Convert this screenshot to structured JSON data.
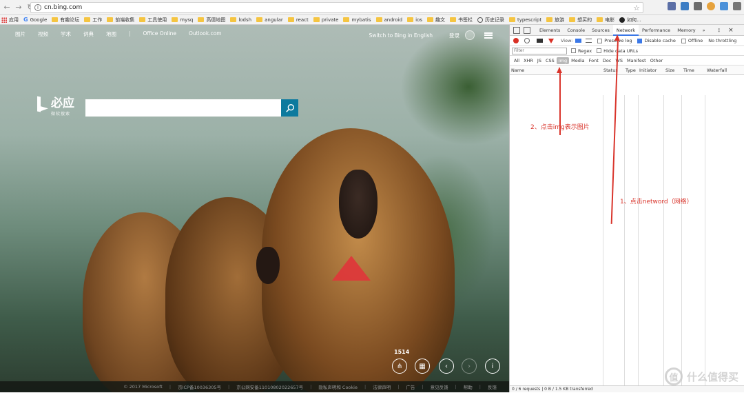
{
  "browser": {
    "url": "cn.bing.com"
  },
  "bookmarks": [
    {
      "label": "应用",
      "icon": "apps-icon"
    },
    {
      "label": "Google",
      "icon": "g-icon"
    },
    {
      "label": "有趣论坛",
      "icon": "folder-icon"
    },
    {
      "label": "工作",
      "icon": "folder-icon"
    },
    {
      "label": "前端收集",
      "icon": "folder-icon"
    },
    {
      "label": "工具使用",
      "icon": "folder-icon"
    },
    {
      "label": "mysq",
      "icon": "folder-icon"
    },
    {
      "label": "高德地图",
      "icon": "folder-icon"
    },
    {
      "label": "lodsh",
      "icon": "folder-icon"
    },
    {
      "label": "angular",
      "icon": "folder-icon"
    },
    {
      "label": "react",
      "icon": "folder-icon"
    },
    {
      "label": "private",
      "icon": "folder-icon"
    },
    {
      "label": "mybatis",
      "icon": "folder-icon"
    },
    {
      "label": "android",
      "icon": "folder-icon"
    },
    {
      "label": "ios",
      "icon": "folder-icon"
    },
    {
      "label": "趣文",
      "icon": "folder-icon"
    },
    {
      "label": "书签栏",
      "icon": "folder-icon"
    },
    {
      "label": "历史记录",
      "icon": "history-icon"
    },
    {
      "label": "typescript",
      "icon": "folder-icon"
    },
    {
      "label": "旅游",
      "icon": "folder-icon"
    },
    {
      "label": "想买的",
      "icon": "folder-icon"
    },
    {
      "label": "电影",
      "icon": "folder-icon"
    },
    {
      "label": "如何...",
      "icon": "github-icon"
    }
  ],
  "bing": {
    "nav": [
      "图片",
      "视频",
      "学术",
      "词典",
      "地图"
    ],
    "nav_right": [
      "Office Online",
      "Outlook.com"
    ],
    "switch_lang": "Switch to Bing in English",
    "login": "登录",
    "logo_cn": "必应",
    "logo_sub": "微软搜索",
    "search_value": "",
    "image_counter": "1514",
    "footer": [
      "© 2017 Microsoft",
      "京ICP备10036305号",
      "京公网安备11010802022657号",
      "隐私声明和 Cookie",
      "法律声明",
      "广告",
      "意见反馈",
      "帮助",
      "反馈"
    ]
  },
  "devtools": {
    "tabs": [
      "Elements",
      "Console",
      "Sources",
      "Network",
      "Performance",
      "Memory"
    ],
    "active_tab": "Network",
    "more": "»",
    "toolbar": {
      "view_label": "View:",
      "preserve_log": "Preserve log",
      "disable_cache": "Disable cache",
      "offline": "Offline",
      "throttling": "No throttling"
    },
    "filter_placeholder": "Filter",
    "regex": "Regex",
    "hide_data_urls": "Hide data URLs",
    "types": [
      "All",
      "XHR",
      "JS",
      "CSS",
      "Img",
      "Media",
      "Font",
      "Doc",
      "WS",
      "Manifest",
      "Other"
    ],
    "active_type": "Img",
    "columns": [
      "Name",
      "Status",
      "Type",
      "Initiator",
      "Size",
      "Time",
      "Waterfall"
    ],
    "status_bar": "0 / 6 requests  |  0 B / 1.5 KB transferred"
  },
  "annotations": {
    "step1": "1、点击netword（网络）",
    "step2": "2、点击img表示图片"
  },
  "watermark": "什么值得买",
  "colors": {
    "accent": "#3b78e7",
    "annotation": "#d9342b",
    "search_button": "#0d7a9e",
    "record": "#d93025"
  }
}
